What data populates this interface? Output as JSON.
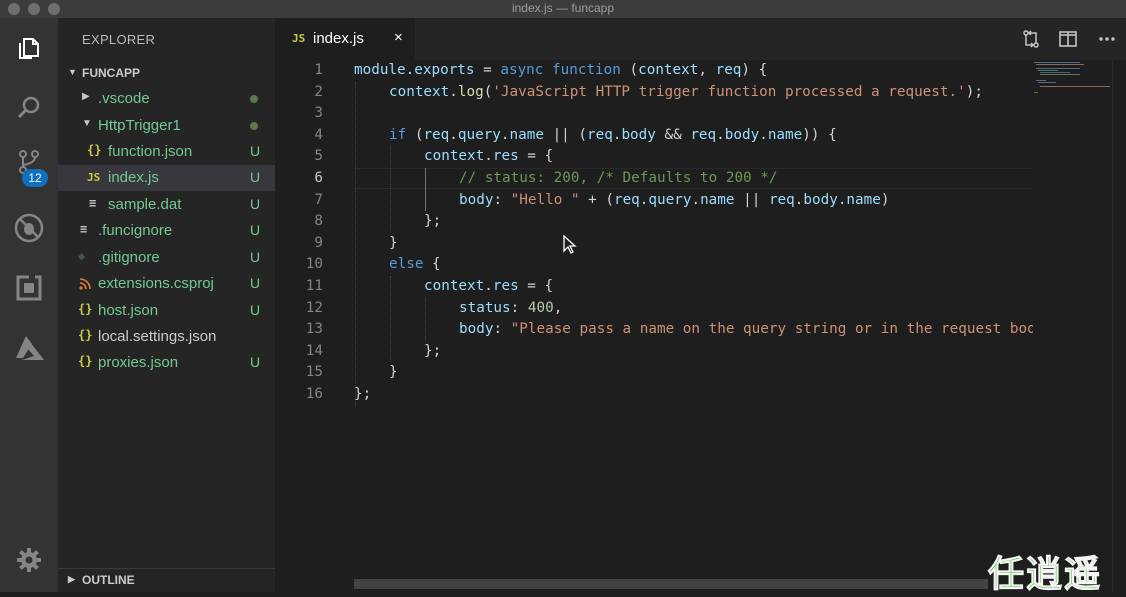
{
  "window": {
    "title": "index.js — funcapp"
  },
  "activity_bar": {
    "items": [
      {
        "icon": "files-icon"
      },
      {
        "icon": "search-icon"
      },
      {
        "icon": "source-control-icon"
      },
      {
        "icon": "debug-icon"
      },
      {
        "icon": "extensions-icon"
      },
      {
        "icon": "azure-icon"
      }
    ],
    "source_control_badge": "12",
    "settings_icon": "gear-icon"
  },
  "sidebar": {
    "title": "EXPLORER",
    "folder": "FUNCAPP",
    "items": [
      {
        "name": ".vscode",
        "kind": "folder-collapsed",
        "status": "dot"
      },
      {
        "name": "HttpTrigger1",
        "kind": "folder-expanded",
        "status": "dot"
      },
      {
        "name": "function.json",
        "icon_text": "{}",
        "status": "U"
      },
      {
        "name": "index.js",
        "icon_text": "JS",
        "status": "U",
        "selected": true
      },
      {
        "name": "sample.dat",
        "icon_text": "≡",
        "status": "U"
      },
      {
        "name": ".funcignore",
        "icon_text": "≡",
        "status": "U"
      },
      {
        "name": ".gitignore",
        "icon_text": "◆",
        "status": "U"
      },
      {
        "name": "extensions.csproj",
        "icon_text": "rss",
        "status": "U"
      },
      {
        "name": "host.json",
        "icon_text": "{}",
        "status": "U"
      },
      {
        "name": "local.settings.json",
        "icon_text": "{}",
        "status": ""
      },
      {
        "name": "proxies.json",
        "icon_text": "{}",
        "status": "U"
      }
    ],
    "outline_label": "OUTLINE"
  },
  "tabs": [
    {
      "label": "index.js",
      "icon_text": "JS",
      "close": "×",
      "active": true
    }
  ],
  "editor": {
    "active_line": 6,
    "lines": [
      {
        "n": "1"
      },
      {
        "n": "2"
      },
      {
        "n": "3"
      },
      {
        "n": "4"
      },
      {
        "n": "5"
      },
      {
        "n": "6"
      },
      {
        "n": "7"
      },
      {
        "n": "8"
      },
      {
        "n": "9"
      },
      {
        "n": "10"
      },
      {
        "n": "11"
      },
      {
        "n": "12"
      },
      {
        "n": "13"
      },
      {
        "n": "14"
      },
      {
        "n": "15"
      },
      {
        "n": "16"
      }
    ],
    "code": {
      "l1": {
        "a": "module",
        "b": ".",
        "c": "exports",
        "d": " = ",
        "e": "async",
        "f": " ",
        "g": "function",
        "h": " (",
        "i": "context",
        "j": ", ",
        "k": "req",
        "l": ") {"
      },
      "l2": {
        "a": "context",
        "b": ".",
        "c": "log",
        "d": "(",
        "e": "'JavaScript HTTP trigger function processed a request.'",
        "f": ");"
      },
      "l4": {
        "a": "if",
        "b": " (",
        "c": "req",
        "d": ".",
        "e": "query",
        "f": ".",
        "g": "name",
        "h": " || (",
        "i": "req",
        "j": ".",
        "k": "body",
        "l": " && ",
        "m": "req",
        "n": ".",
        "o": "body",
        "p": ".",
        "q": "name",
        "r": ")) {"
      },
      "l5": {
        "a": "context",
        "b": ".",
        "c": "res",
        "d": " = {"
      },
      "l6": {
        "a": "// status: 200, /* Defaults to 200 */"
      },
      "l7": {
        "a": "body",
        "b": ": ",
        "c": "\"Hello \"",
        "d": " + (",
        "e": "req",
        "f": ".",
        "g": "query",
        "h": ".",
        "i": "name",
        "j": " || ",
        "k": "req",
        "l": ".",
        "m": "body",
        "n": ".",
        "o": "name",
        "p": ")"
      },
      "l8": {
        "a": "};"
      },
      "l9": {
        "a": "}"
      },
      "l10": {
        "a": "else",
        "b": " {"
      },
      "l11": {
        "a": "context",
        "b": ".",
        "c": "res",
        "d": " = {"
      },
      "l12": {
        "a": "status",
        "b": ": ",
        "c": "400",
        "d": ","
      },
      "l13": {
        "a": "body",
        "b": ": ",
        "c": "\"Please pass a name on the query string or in the request boo"
      },
      "l14": {
        "a": "};"
      },
      "l15": {
        "a": "}"
      },
      "l16": {
        "a": "};"
      }
    }
  },
  "watermark": "任逍遥",
  "colors": {
    "keyword": "#569cd6",
    "variable": "#9cdcfe",
    "function": "#dcdcaa",
    "string": "#ce9178",
    "comment": "#6a9955",
    "number": "#b5cea8",
    "untracked": "#73c991",
    "badge": "#0e70c0"
  }
}
